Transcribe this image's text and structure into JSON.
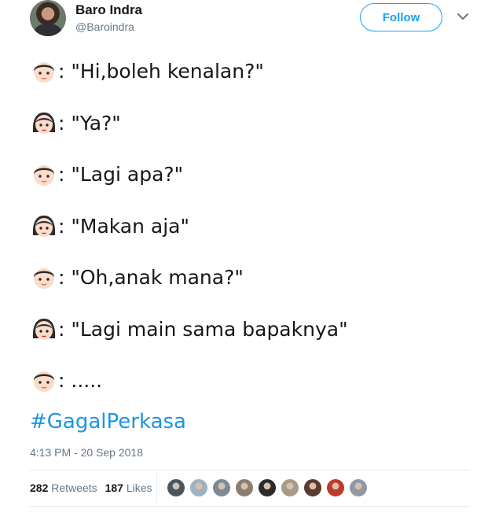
{
  "tweet": {
    "author_name": "Baro Indra",
    "author_handle": "@Baroindra",
    "follow_label": "Follow",
    "lines": [
      {
        "speaker": "boy",
        "text": ": \"Hi,boleh kenalan?\""
      },
      {
        "speaker": "girl",
        "text": ": \"Ya?\""
      },
      {
        "speaker": "boy",
        "text": ": \"Lagi apa?\""
      },
      {
        "speaker": "girl",
        "text": ": \"Makan aja\""
      },
      {
        "speaker": "boy",
        "text": ": \"Oh,anak mana?\""
      },
      {
        "speaker": "girl",
        "text": ": \"Lagi main sama bapaknya\""
      },
      {
        "speaker": "boy",
        "text": ": ....."
      }
    ],
    "hashtag": "#GagalPerkasa",
    "timestamp": "4:13 PM - 20 Sep 2018",
    "retweets_count": "282",
    "retweets_label": "Retweets",
    "likes_count": "187",
    "likes_label": "Likes",
    "liker_colors": [
      "#4a5560",
      "#9fb3c0",
      "#7d8a96",
      "#8a7e72",
      "#2b2b2b",
      "#a89a88",
      "#5a3b2e",
      "#c0392b",
      "#8e99a4"
    ]
  },
  "colors": {
    "accent": "#1da1f2",
    "hashtag": "#1b95e0",
    "muted": "#657786"
  }
}
